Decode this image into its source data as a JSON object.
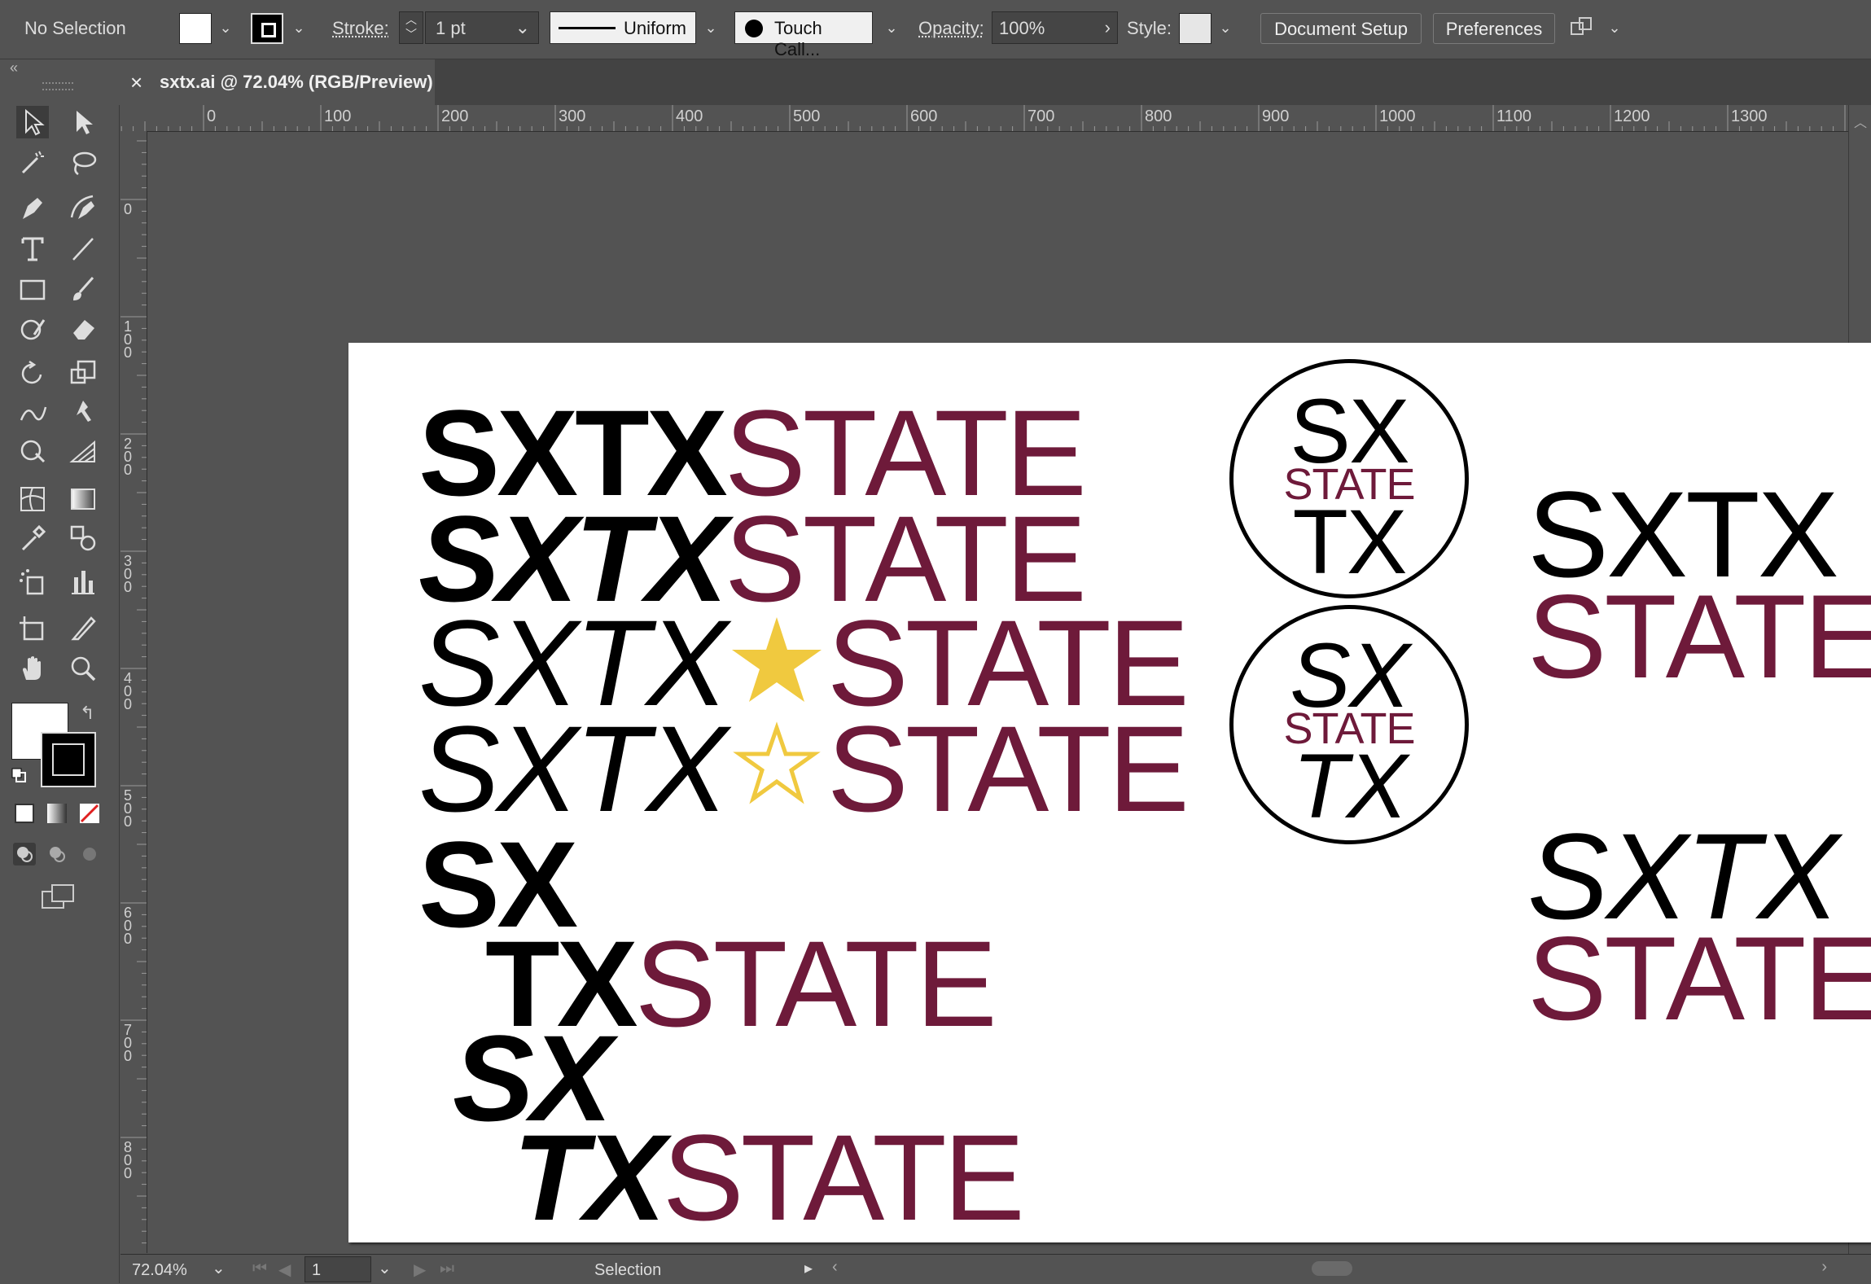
{
  "control_bar": {
    "selection_label": "No Selection",
    "stroke_label": "Stroke:",
    "stroke_weight": "1 pt",
    "profile_label": "Uniform",
    "brush_label": "Touch Call...",
    "opacity_label": "Opacity:",
    "opacity_value": "100%",
    "style_label": "Style:",
    "document_setup_button": "Document Setup",
    "preferences_button": "Preferences",
    "arrange_icon": "arrange-documents-icon"
  },
  "tab": {
    "close_glyph": "×",
    "title": "sxtx.ai @ 72.04% (RGB/Preview)"
  },
  "ruler": {
    "h_ticks": [
      "0",
      "100",
      "200",
      "300",
      "400",
      "500",
      "600",
      "700",
      "800",
      "900",
      "1000",
      "1100",
      "1200",
      "1300"
    ],
    "v_ticks": [
      "0",
      "100",
      "200",
      "300",
      "400",
      "500",
      "600",
      "700",
      "800"
    ]
  },
  "tools": [
    "selection-tool-icon",
    "direct-selection-tool-icon",
    "magic-wand-tool-icon",
    "lasso-tool-icon",
    "pen-tool-icon",
    "curvature-tool-icon",
    "type-tool-icon",
    "line-segment-tool-icon",
    "rectangle-tool-icon",
    "paintbrush-tool-icon",
    "shaper-tool-icon",
    "eraser-tool-icon",
    "rotate-tool-icon",
    "scale-tool-icon",
    "warp-tool-icon",
    "puppet-warp-tool-icon",
    "free-transform-tool-icon",
    "perspective-grid-tool-icon",
    "mesh-tool-icon",
    "gradient-tool-icon",
    "eyedropper-tool-icon",
    "blend-tool-icon",
    "symbol-sprayer-tool-icon",
    "column-graph-tool-icon",
    "artboard-tool-icon",
    "slice-tool-icon",
    "hand-tool-icon",
    "zoom-tool-icon"
  ],
  "colors": {
    "black": "#000000",
    "maroon": "#6e1a3a",
    "gold": "#f0c93f",
    "artboard": "#ffffff"
  },
  "artwork": {
    "row1": {
      "sxtx": "SXTX",
      "state": "STATE"
    },
    "row2": {
      "sxtx": "SXTX",
      "state": "STATE"
    },
    "row3": {
      "sxtx": "SXTX",
      "state": "STATE",
      "icon": "filled-star-icon"
    },
    "row4": {
      "sxtx": "SXTX",
      "state": "STATE",
      "icon": "outline-star-icon"
    },
    "stack1": {
      "sx": "SX",
      "tx": "TX",
      "state": "STATE"
    },
    "stack2": {
      "sx": "SX",
      "tx": "TX",
      "state": "STATE"
    },
    "badge1": {
      "sx": "SX",
      "state": "STATE",
      "tx": "TX"
    },
    "badge2": {
      "sx": "SX",
      "state": "STATE",
      "tx": "TX"
    },
    "right1": {
      "sxtx": "SXTX",
      "state": "STATE"
    },
    "right2": {
      "sxtx": "SXTX",
      "state": "STATE"
    }
  },
  "status_bar": {
    "zoom": "72.04%",
    "artboard_number": "1",
    "tool_name": "Selection"
  }
}
